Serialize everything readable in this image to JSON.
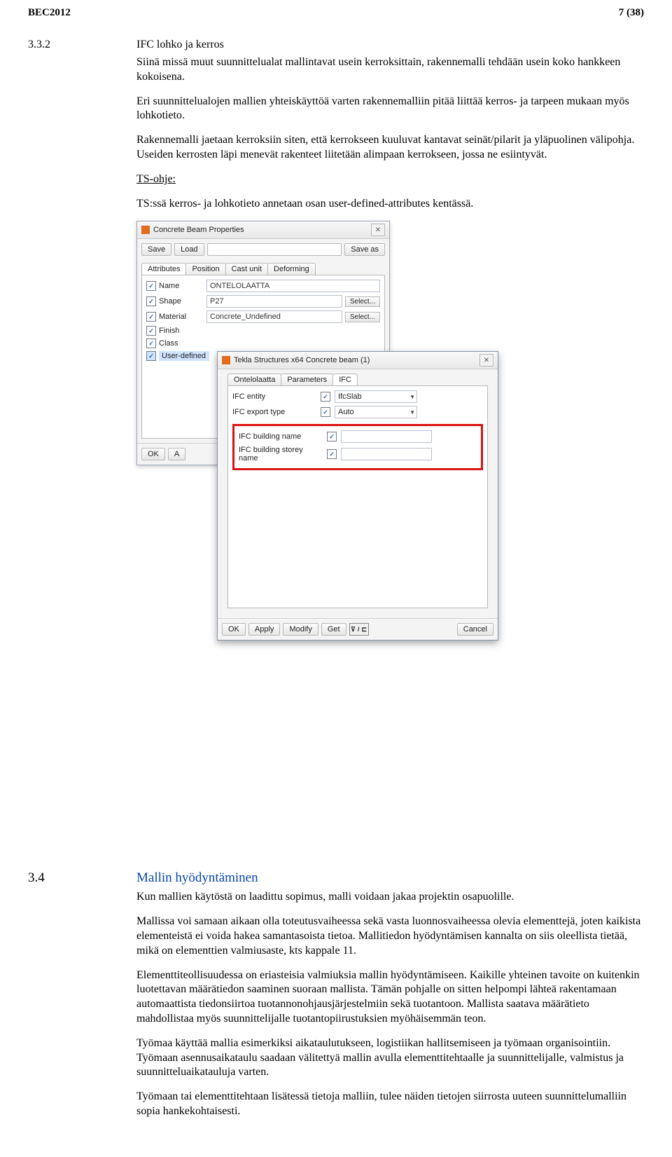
{
  "header": {
    "left": "BEC2012",
    "right": "7 (38)"
  },
  "section332": {
    "num": "3.3.2",
    "title": "IFC lohko ja kerros",
    "p1": "Siinä missä muut suunnittelualat mallintavat usein kerroksittain, rakennemalli tehdään usein koko hankkeen kokoisena.",
    "p2": "Eri suunnittelualojen mallien yhteiskäyttöä varten rakennemalliin pitää liittää kerros- ja tarpeen mukaan myös lohkotieto.",
    "p3": "Rakennemalli jaetaan kerroksiin siten, että kerrokseen kuuluvat kantavat seinät/pilarit ja yläpuolinen välipohja. Useiden kerrosten läpi menevät rakenteet liitetään alimpaan kerrokseen, jossa ne esiintyvät.",
    "ts_ohje_label": "TS-ohje:",
    "p4": "TS:ssä kerros- ja lohkotieto annetaan osan user-defined-attributes kentässä."
  },
  "screenshot": {
    "outer": {
      "title": "Concrete Beam Properties",
      "save": "Save",
      "load": "Load",
      "saveas": "Save as",
      "tabs": [
        "Attributes",
        "Position",
        "Cast unit",
        "Deforming"
      ],
      "rows": {
        "name": {
          "label": "Name",
          "value": "ONTELOLAATTA"
        },
        "shape": {
          "label": "Shape",
          "value": "P27",
          "btn": "Select..."
        },
        "material": {
          "label": "Material",
          "value": "Concrete_Undefined",
          "btn": "Select..."
        },
        "finish": {
          "label": "Finish",
          "value": ""
        },
        "class": {
          "label": "Class",
          "value": ""
        },
        "userdef": {
          "label": "User-defined"
        }
      },
      "ok": "OK"
    },
    "inner": {
      "title": "Tekla Structures x64  Concrete beam (1)",
      "tabs": [
        "Ontelolaatta",
        "Parameters",
        "IFC"
      ],
      "ifc_entity_label": "IFC entity",
      "ifc_entity_value": "IfcSlab",
      "ifc_export_label": "IFC export type",
      "ifc_export_value": "Auto",
      "building_name_label": "IFC building name",
      "building_storey_label": "IFC building storey name",
      "btns": {
        "ok": "OK",
        "apply": "Apply",
        "modify": "Modify",
        "get": "Get",
        "cancel": "Cancel"
      }
    }
  },
  "section34": {
    "num": "3.4",
    "title": "Mallin hyödyntäminen",
    "p1": "Kun mallien käytöstä on laadittu sopimus, malli voidaan jakaa projektin osapuolille.",
    "p2": "Mallissa voi samaan aikaan olla toteutusvaiheessa sekä vasta luonnosvaiheessa olevia elementtejä, joten kaikista elementeistä ei voida hakea samantasoista tietoa. Mallitiedon hyödyntämisen kannalta on siis oleellista tietää, mikä on elementtien valmiusaste, kts kappale 11.",
    "p3": "Elementtiteollisuudessa on eriasteisia valmiuksia mallin hyödyntämiseen. Kaikille yhteinen tavoite on kuitenkin luotettavan määrätiedon saaminen suoraan mallista. Tämän pohjalle on sitten helpompi lähteä rakentamaan automaattista tiedonsiirtoa tuotannonohjausjärjestelmiin sekä tuotantoon. Mallista saatava määrätieto mahdollistaa myös suunnittelijalle tuotantopiirustuksien myöhäisemmän teon.",
    "p4": "Työmaa käyttää mallia esimerkiksi aikataulutukseen, logistiikan hallitsemiseen ja työmaan organisointiin. Työmaan asennusaikataulu saadaan välitettyä mallin avulla elementtitehtaalle ja suunnittelijalle, valmistus ja suunnitteluaikatauluja varten.",
    "p5": "Työmaan tai elementtitehtaan lisätessä tietoja malliin, tulee näiden tietojen siirrosta uuteen suunnittelumalliin sopia hankekohtaisesti."
  }
}
